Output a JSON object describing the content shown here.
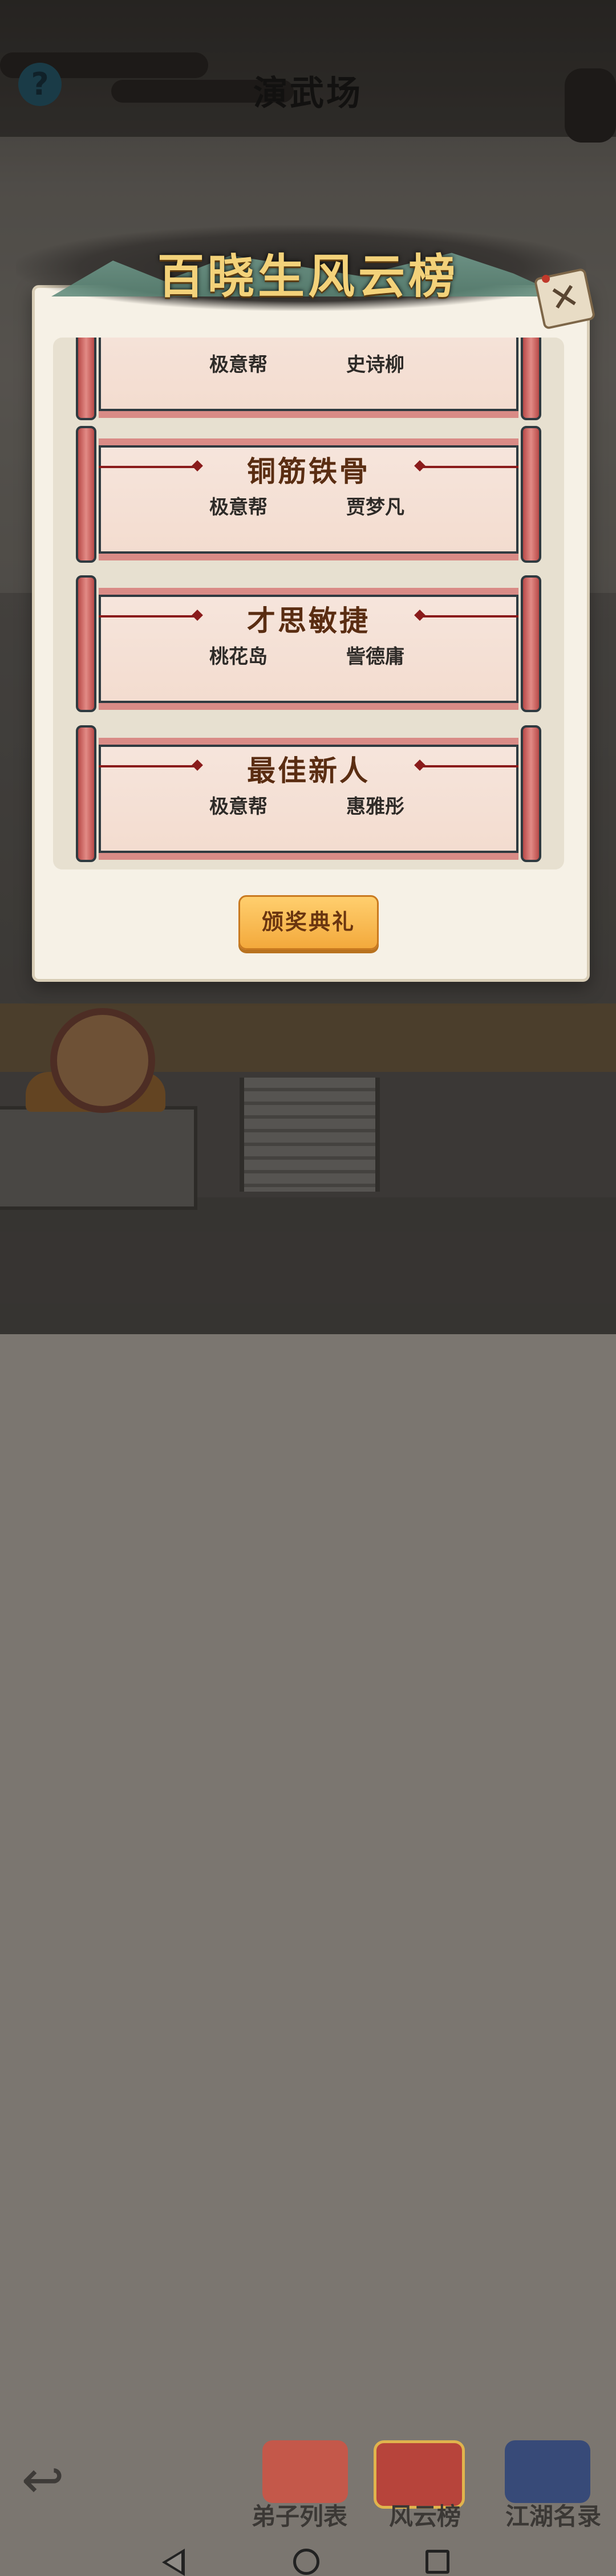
{
  "header": {
    "title": "演武场",
    "help_icon": "question-mark-icon"
  },
  "popup": {
    "title": "百晓生风云榜",
    "close_icon": "close-icon",
    "awards": [
      {
        "title": "",
        "sect": "极意帮",
        "winner": "史诗柳",
        "partial": true
      },
      {
        "title": "铜筋铁骨",
        "sect": "极意帮",
        "winner": "贾梦凡"
      },
      {
        "title": "才思敏捷",
        "sect": "桃花岛",
        "winner": "訾德庸"
      },
      {
        "title": "最佳新人",
        "sect": "极意帮",
        "winner": "惠雅彤"
      }
    ],
    "ceremony_button": "颁奖典礼"
  },
  "bottom_menu": {
    "items": [
      {
        "label": "弟子列表",
        "icon": "disciple-icon"
      },
      {
        "label": "风云榜",
        "icon": "ranking-scroll-icon"
      },
      {
        "label": "江湖名录",
        "icon": "book-icon"
      }
    ],
    "back_icon": "back-arrow-icon"
  },
  "system_nav": {
    "back": "nav-back-icon",
    "home": "nav-home-icon",
    "recent": "nav-recent-icon"
  },
  "colors": {
    "banner_text": "#f3d27a",
    "scroll_roller": "#d98b86",
    "button": "#f3a93c"
  }
}
